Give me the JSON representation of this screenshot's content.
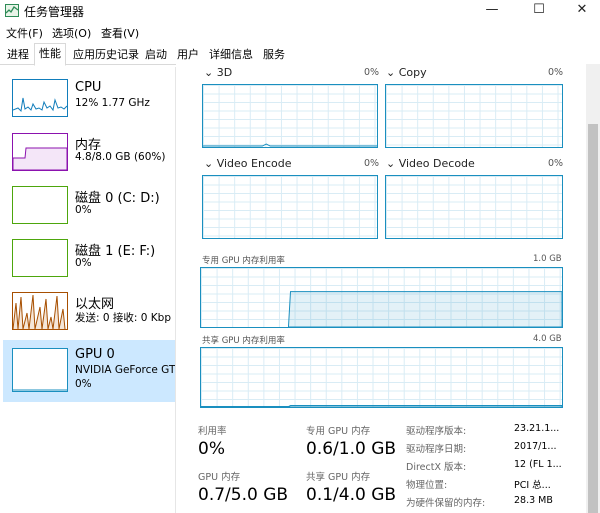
{
  "window": {
    "title": "任务管理器",
    "minimize": "—",
    "maximize": "☐",
    "close": "✕"
  },
  "menu": [
    "文件(F)",
    "选项(O)",
    "查看(V)"
  ],
  "tabs": [
    "进程",
    "性能",
    "应用历史记录",
    "启动",
    "用户",
    "详细信息",
    "服务"
  ],
  "active_tab": "性能",
  "sidebar": [
    {
      "name": "CPU",
      "sub": "12% 1.77 GHz",
      "color": "#117dbb"
    },
    {
      "name": "内存",
      "sub": "4.8/8.0 GB (60%)",
      "color": "#8b12ae"
    },
    {
      "name": "磁盘 0 (C: D:)",
      "sub": "0%",
      "color": "#4da60c"
    },
    {
      "name": "磁盘 1 (E: F:)",
      "sub": "0%",
      "color": "#4da60c"
    },
    {
      "name": "以太网",
      "sub": "发送: 0 接收: 0 Kbp",
      "color": "#a74f01"
    },
    {
      "name": "GPU 0",
      "sub": "NVIDIA GeForce GT",
      "sub2": "0%",
      "color": "#1a8fbf"
    }
  ],
  "engines": [
    {
      "name": "3D",
      "pct": "0%"
    },
    {
      "name": "Copy",
      "pct": "0%"
    },
    {
      "name": "Video Encode",
      "pct": "0%"
    },
    {
      "name": "Video Decode",
      "pct": "0%"
    }
  ],
  "dedicated": {
    "label": "专用 GPU 内存利用率",
    "max": "1.0 GB",
    "level": 0.6
  },
  "shared": {
    "label": "共享 GPU 内存利用率",
    "max": "4.0 GB",
    "level": 0.025
  },
  "stats": {
    "util_label": "利用率",
    "util_value": "0%",
    "ded_label": "专用 GPU 内存",
    "ded_value": "0.6/1.0 GB",
    "gpu_mem_label": "GPU 内存",
    "gpu_mem_value": "0.7/5.0 GB",
    "shared_label": "共享 GPU 内存",
    "shared_value": "0.1/4.0 GB"
  },
  "properties": [
    {
      "label": "驱动程序版本:",
      "value": "23.21.1..."
    },
    {
      "label": "驱动程序日期:",
      "value": "2017/1..."
    },
    {
      "label": "DirectX 版本:",
      "value": "12 (FL 1..."
    },
    {
      "label": "物理位置:",
      "value": "PCI 总..."
    },
    {
      "label": "为硬件保留的内存:",
      "value": "28.3 MB"
    }
  ]
}
